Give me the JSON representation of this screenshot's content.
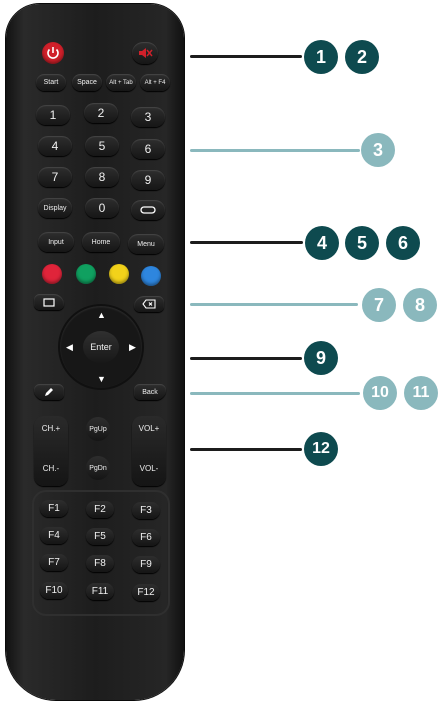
{
  "top_row": {
    "start": "Start",
    "space": "Space",
    "alt_tab": "Alt + Tab",
    "alt_f4": "Alt + F4"
  },
  "numbers": [
    "1",
    "2",
    "3",
    "4",
    "5",
    "6",
    "7",
    "8",
    "9"
  ],
  "bottom_num_row": {
    "display": "Display",
    "zero": "0"
  },
  "menu_row": {
    "input": "Input",
    "home": "Home",
    "menu": "Menu"
  },
  "dpad": {
    "enter": "Enter"
  },
  "back": "Back",
  "channel": {
    "up": "CH.+",
    "down": "CH.-"
  },
  "page": {
    "up": "PgUp",
    "down": "PgDn"
  },
  "volume": {
    "up": "VOL+",
    "down": "VOL-"
  },
  "function_keys": [
    "F1",
    "F2",
    "F3",
    "F4",
    "F5",
    "F6",
    "F7",
    "F8",
    "F9",
    "F10",
    "F11",
    "F12"
  ],
  "callouts": [
    "1",
    "2",
    "3",
    "4",
    "5",
    "6",
    "7",
    "8",
    "9",
    "10",
    "11",
    "12"
  ],
  "colors": {
    "power": "#d0202a",
    "dark_callout": "#0e4a4f",
    "light_callout": "#8ab8bd",
    "red": "#e0243a",
    "green": "#10a060",
    "yellow": "#f2d21a",
    "blue": "#2e86de"
  }
}
